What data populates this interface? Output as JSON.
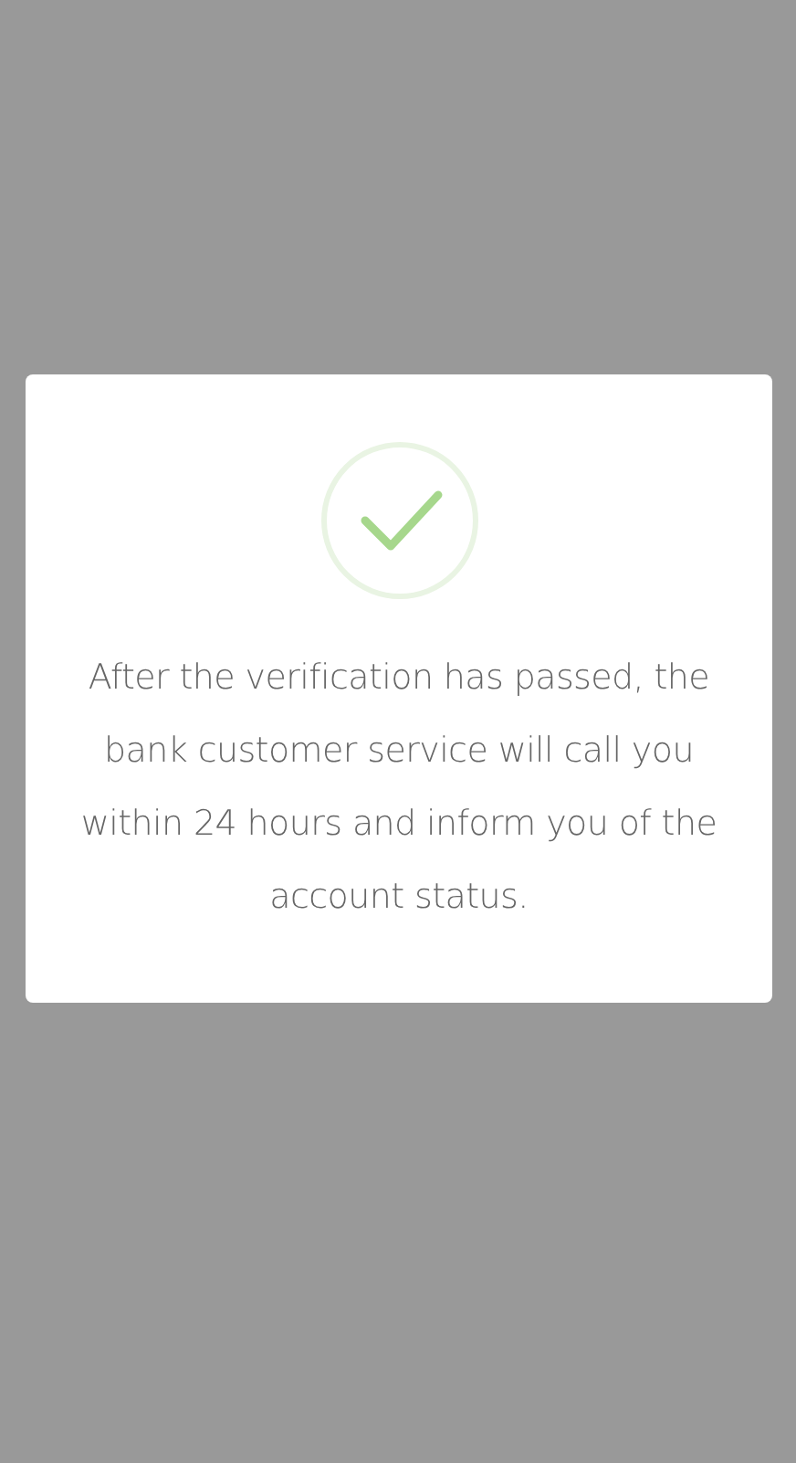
{
  "dialog": {
    "kind": "success",
    "message": "After the verification has passed, the bank customer service will call you within 24 hours and inform you of the account status."
  }
}
